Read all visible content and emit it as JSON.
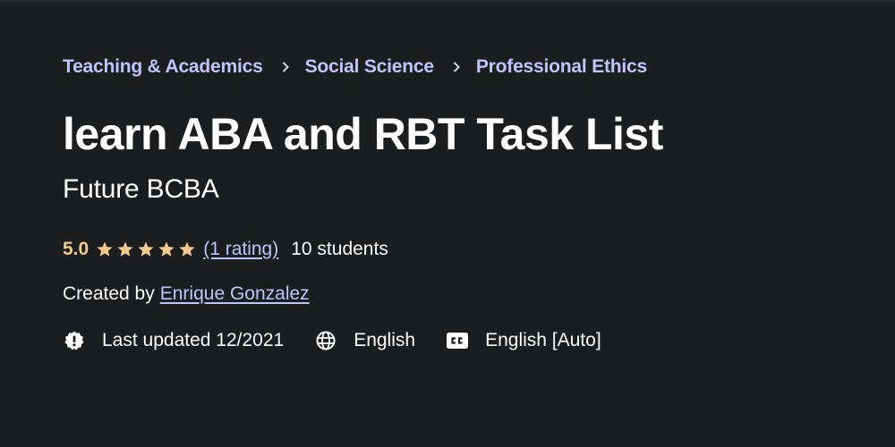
{
  "breadcrumb": [
    {
      "label": "Teaching & Academics"
    },
    {
      "label": "Social Science"
    },
    {
      "label": "Professional Ethics"
    }
  ],
  "course": {
    "title": "learn ABA and RBT Task List",
    "subtitle": "Future BCBA",
    "rating_value": "5.0",
    "stars": 5,
    "rating_count_label": "(1 rating)",
    "students_label": "10 students",
    "created_by_label": "Created by",
    "instructor": "Enrique Gonzalez"
  },
  "meta": {
    "last_updated": {
      "icon": "alert-badge-icon",
      "label": "Last updated 12/2021"
    },
    "language": {
      "icon": "globe-icon",
      "label": "English"
    },
    "captions": {
      "icon": "closed-captions-icon",
      "label": "English [Auto]"
    }
  },
  "colors": {
    "background": "#1c1d1f",
    "link": "#c0c4fc",
    "rating": "#f3ca8c",
    "text": "#ffffff"
  }
}
